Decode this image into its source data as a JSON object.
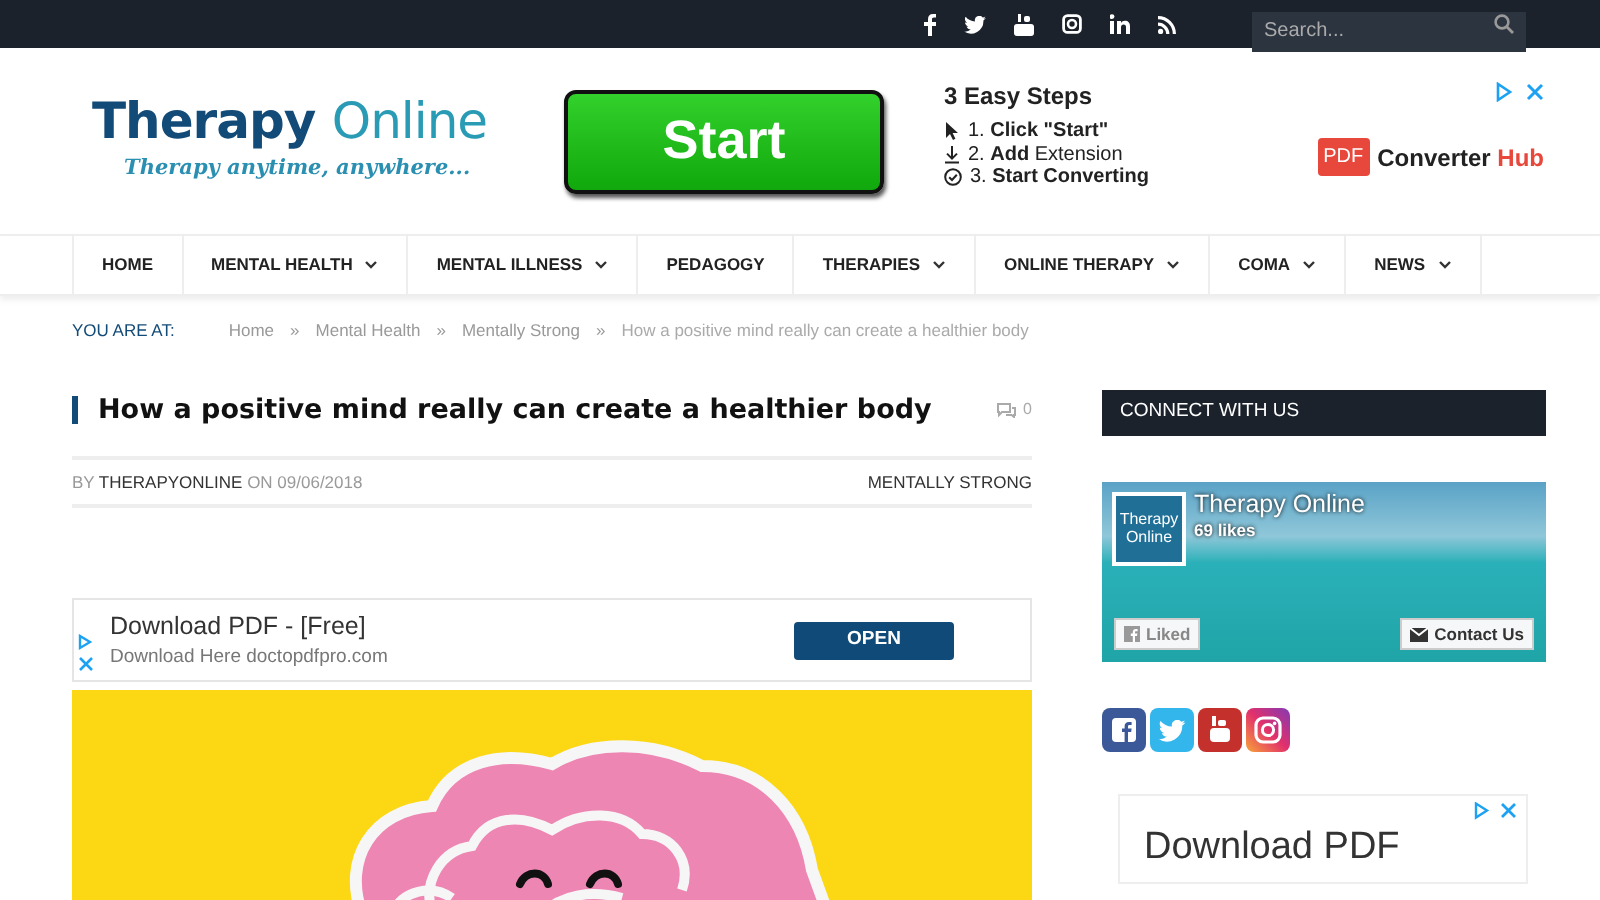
{
  "top_bar": {
    "search": {
      "placeholder": "Search..."
    }
  },
  "header": {
    "logo": {
      "word_1": "Therapy",
      "word_2": "Online",
      "tagline": "Therapy anytime, anywhere..."
    },
    "ad": {
      "button": "Start",
      "steps_title": "3 Easy Steps",
      "steps": [
        {
          "kind": "cursor",
          "text": "1. **Click \"Start\"**"
        },
        {
          "kind": "download",
          "text": "2. **Add** Extension"
        },
        {
          "kind": "check",
          "text": "3. **Start Converting**"
        }
      ],
      "brand": {
        "badge": "PDF",
        "word_1": "Converter",
        "word_2": "Hub"
      }
    }
  },
  "nav": {
    "items": [
      {
        "label": "HOME",
        "dropdown": false
      },
      {
        "label": "MENTAL HEALTH",
        "dropdown": true
      },
      {
        "label": "MENTAL ILLNESS",
        "dropdown": true
      },
      {
        "label": "PEDAGOGY",
        "dropdown": false
      },
      {
        "label": "THERAPIES",
        "dropdown": true
      },
      {
        "label": "ONLINE THERAPY",
        "dropdown": true
      },
      {
        "label": "COMA",
        "dropdown": true
      },
      {
        "label": "NEWS",
        "dropdown": true
      }
    ]
  },
  "breadcrumb": {
    "label": "YOU ARE AT:",
    "items": [
      "Home",
      "Mental Health",
      "Mentally Strong"
    ],
    "current": "How a positive mind really can create a healthier body",
    "separator": "»"
  },
  "article": {
    "title": "How a positive mind really can create a healthier body",
    "comments": "0",
    "byline": {
      "by": "BY",
      "author": "THERAPYONLINE",
      "on": "ON",
      "date": "09/06/2018"
    },
    "category": "MENTALLY STRONG",
    "ad": {
      "title": "Download PDF - [Free]",
      "subtitle": "Download Here doctopdfpro.com",
      "button": "OPEN"
    }
  },
  "sidebar": {
    "heading": "CONNECT WITH US",
    "page_widget": {
      "logo_line_1": "Therapy",
      "logo_line_2": "Online",
      "name": "Therapy Online",
      "likes": "69 likes",
      "like_button": "Liked",
      "contact_button": "Contact Us"
    },
    "ad": {
      "title": "Download PDF"
    }
  }
}
